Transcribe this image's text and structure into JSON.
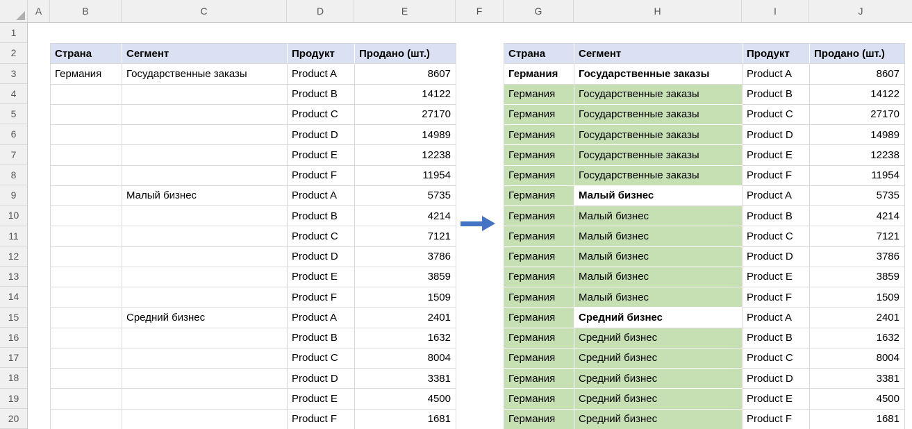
{
  "spreadsheet": {
    "column_letters": [
      "A",
      "B",
      "C",
      "D",
      "E",
      "F",
      "G",
      "H",
      "I",
      "J"
    ],
    "row_numbers": [
      "1",
      "2",
      "3",
      "4",
      "5",
      "6",
      "7",
      "8",
      "9",
      "10",
      "11",
      "12",
      "13",
      "14",
      "15",
      "16",
      "17",
      "18",
      "19",
      "20"
    ]
  },
  "colors": {
    "table_header_fill": "#D9E1F2",
    "filled_highlight_green": "#C6E0B4",
    "arrow_blue": "#4472C4",
    "header_strip_gray": "#F0F0F0"
  },
  "left_table": {
    "headers": [
      "Страна",
      "Сегмент",
      "Продукт",
      "Продано (шт.)"
    ],
    "rows": [
      {
        "cells": [
          "Германия",
          "Государственные заказы",
          "Product A",
          "8607"
        ],
        "styles": [
          "",
          "",
          "",
          ""
        ]
      },
      {
        "cells": [
          "",
          "",
          "Product B",
          "14122"
        ],
        "styles": [
          "",
          "",
          "",
          ""
        ]
      },
      {
        "cells": [
          "",
          "",
          "Product C",
          "27170"
        ],
        "styles": [
          "",
          "",
          "",
          ""
        ]
      },
      {
        "cells": [
          "",
          "",
          "Product D",
          "14989"
        ],
        "styles": [
          "",
          "",
          "",
          ""
        ]
      },
      {
        "cells": [
          "",
          "",
          "Product E",
          "12238"
        ],
        "styles": [
          "",
          "",
          "",
          ""
        ]
      },
      {
        "cells": [
          "",
          "",
          "Product F",
          "11954"
        ],
        "styles": [
          "",
          "",
          "",
          ""
        ]
      },
      {
        "cells": [
          "",
          "Малый бизнес",
          "Product A",
          "5735"
        ],
        "styles": [
          "",
          "",
          "",
          ""
        ]
      },
      {
        "cells": [
          "",
          "",
          "Product B",
          "4214"
        ],
        "styles": [
          "",
          "",
          "",
          ""
        ]
      },
      {
        "cells": [
          "",
          "",
          "Product C",
          "7121"
        ],
        "styles": [
          "",
          "",
          "",
          ""
        ]
      },
      {
        "cells": [
          "",
          "",
          "Product D",
          "3786"
        ],
        "styles": [
          "",
          "",
          "",
          ""
        ]
      },
      {
        "cells": [
          "",
          "",
          "Product E",
          "3859"
        ],
        "styles": [
          "",
          "",
          "",
          ""
        ]
      },
      {
        "cells": [
          "",
          "",
          "Product F",
          "1509"
        ],
        "styles": [
          "",
          "",
          "",
          ""
        ]
      },
      {
        "cells": [
          "",
          "Средний бизнес",
          "Product A",
          "2401"
        ],
        "styles": [
          "",
          "",
          "",
          ""
        ]
      },
      {
        "cells": [
          "",
          "",
          "Product B",
          "1632"
        ],
        "styles": [
          "",
          "",
          "",
          ""
        ]
      },
      {
        "cells": [
          "",
          "",
          "Product C",
          "8004"
        ],
        "styles": [
          "",
          "",
          "",
          ""
        ]
      },
      {
        "cells": [
          "",
          "",
          "Product D",
          "3381"
        ],
        "styles": [
          "",
          "",
          "",
          ""
        ]
      },
      {
        "cells": [
          "",
          "",
          "Product E",
          "4500"
        ],
        "styles": [
          "",
          "",
          "",
          ""
        ]
      },
      {
        "cells": [
          "",
          "",
          "Product F",
          "1681"
        ],
        "styles": [
          "",
          "",
          "",
          ""
        ]
      }
    ]
  },
  "right_table": {
    "headers": [
      "Страна",
      "Сегмент",
      "Продукт",
      "Продано (шт.)"
    ],
    "rows": [
      {
        "cells": [
          "Германия",
          "Государственные заказы",
          "Product A",
          "8607"
        ],
        "styles": [
          "bold",
          "bold",
          "",
          ""
        ]
      },
      {
        "cells": [
          "Германия",
          "Государственные заказы",
          "Product B",
          "14122"
        ],
        "styles": [
          "green",
          "green",
          "",
          ""
        ]
      },
      {
        "cells": [
          "Германия",
          "Государственные заказы",
          "Product C",
          "27170"
        ],
        "styles": [
          "green",
          "green",
          "",
          ""
        ]
      },
      {
        "cells": [
          "Германия",
          "Государственные заказы",
          "Product D",
          "14989"
        ],
        "styles": [
          "green",
          "green",
          "",
          ""
        ]
      },
      {
        "cells": [
          "Германия",
          "Государственные заказы",
          "Product E",
          "12238"
        ],
        "styles": [
          "green",
          "green",
          "",
          ""
        ]
      },
      {
        "cells": [
          "Германия",
          "Государственные заказы",
          "Product F",
          "11954"
        ],
        "styles": [
          "green",
          "green",
          "",
          ""
        ]
      },
      {
        "cells": [
          "Германия",
          "Малый бизнес",
          "Product A",
          "5735"
        ],
        "styles": [
          "green",
          "bold",
          "",
          ""
        ]
      },
      {
        "cells": [
          "Германия",
          "Малый бизнес",
          "Product B",
          "4214"
        ],
        "styles": [
          "green",
          "green",
          "",
          ""
        ]
      },
      {
        "cells": [
          "Германия",
          "Малый бизнес",
          "Product C",
          "7121"
        ],
        "styles": [
          "green",
          "green",
          "",
          ""
        ]
      },
      {
        "cells": [
          "Германия",
          "Малый бизнес",
          "Product D",
          "3786"
        ],
        "styles": [
          "green",
          "green",
          "",
          ""
        ]
      },
      {
        "cells": [
          "Германия",
          "Малый бизнес",
          "Product E",
          "3859"
        ],
        "styles": [
          "green",
          "green",
          "",
          ""
        ]
      },
      {
        "cells": [
          "Германия",
          "Малый бизнес",
          "Product F",
          "1509"
        ],
        "styles": [
          "green",
          "green",
          "",
          ""
        ]
      },
      {
        "cells": [
          "Германия",
          "Средний бизнес",
          "Product A",
          "2401"
        ],
        "styles": [
          "green",
          "bold",
          "",
          ""
        ]
      },
      {
        "cells": [
          "Германия",
          "Средний бизнес",
          "Product B",
          "1632"
        ],
        "styles": [
          "green",
          "green",
          "",
          ""
        ]
      },
      {
        "cells": [
          "Германия",
          "Средний бизнес",
          "Product C",
          "8004"
        ],
        "styles": [
          "green",
          "green",
          "",
          ""
        ]
      },
      {
        "cells": [
          "Германия",
          "Средний бизнес",
          "Product D",
          "3381"
        ],
        "styles": [
          "green",
          "green",
          "",
          ""
        ]
      },
      {
        "cells": [
          "Германия",
          "Средний бизнес",
          "Product E",
          "4500"
        ],
        "styles": [
          "green",
          "green",
          "",
          ""
        ]
      },
      {
        "cells": [
          "Германия",
          "Средний бизнес",
          "Product F",
          "1681"
        ],
        "styles": [
          "green",
          "green",
          "",
          ""
        ]
      }
    ]
  }
}
